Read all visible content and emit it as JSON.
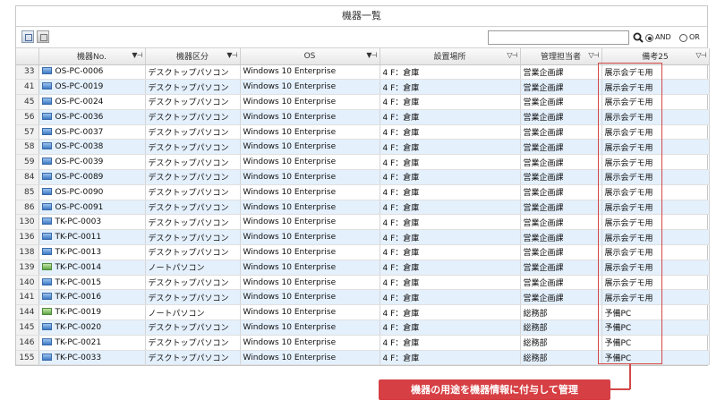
{
  "window": {
    "title": "機器一覧"
  },
  "toolbar": {
    "search": {
      "value": "",
      "placeholder": ""
    },
    "logic": {
      "and_label": "AND",
      "or_label": "OR",
      "selected": "AND"
    }
  },
  "columns": [
    {
      "label": ""
    },
    {
      "label": "機器No."
    },
    {
      "label": "機器区分"
    },
    {
      "label": "OS"
    },
    {
      "label": "設置場所"
    },
    {
      "label": "管理担当者"
    },
    {
      "label": "備考25"
    }
  ],
  "rows": [
    {
      "num": "33",
      "icon": "desktop-icon",
      "id": "OS-PC-0006",
      "category": "デスクトップパソコン",
      "os": "Windows 10 Enterprise",
      "location": "4 F：倉庫",
      "manager": "営業企画課",
      "note": "展示会デモ用"
    },
    {
      "num": "41",
      "icon": "desktop-icon",
      "id": "OS-PC-0019",
      "category": "デスクトップパソコン",
      "os": "Windows 10 Enterprise",
      "location": "4 F：倉庫",
      "manager": "営業企画課",
      "note": "展示会デモ用"
    },
    {
      "num": "45",
      "icon": "desktop-icon",
      "id": "OS-PC-0024",
      "category": "デスクトップパソコン",
      "os": "Windows 10 Enterprise",
      "location": "4 F：倉庫",
      "manager": "営業企画課",
      "note": "展示会デモ用"
    },
    {
      "num": "56",
      "icon": "desktop-icon",
      "id": "OS-PC-0036",
      "category": "デスクトップパソコン",
      "os": "Windows 10 Enterprise",
      "location": "4 F：倉庫",
      "manager": "営業企画課",
      "note": "展示会デモ用"
    },
    {
      "num": "57",
      "icon": "desktop-icon",
      "id": "OS-PC-0037",
      "category": "デスクトップパソコン",
      "os": "Windows 10 Enterprise",
      "location": "4 F：倉庫",
      "manager": "営業企画課",
      "note": "展示会デモ用"
    },
    {
      "num": "58",
      "icon": "desktop-icon",
      "id": "OS-PC-0038",
      "category": "デスクトップパソコン",
      "os": "Windows 10 Enterprise",
      "location": "4 F：倉庫",
      "manager": "営業企画課",
      "note": "展示会デモ用"
    },
    {
      "num": "59",
      "icon": "desktop-icon",
      "id": "OS-PC-0039",
      "category": "デスクトップパソコン",
      "os": "Windows 10 Enterprise",
      "location": "4 F：倉庫",
      "manager": "営業企画課",
      "note": "展示会デモ用"
    },
    {
      "num": "84",
      "icon": "desktop-icon",
      "id": "OS-PC-0089",
      "category": "デスクトップパソコン",
      "os": "Windows 10 Enterprise",
      "location": "4 F：倉庫",
      "manager": "営業企画課",
      "note": "展示会デモ用"
    },
    {
      "num": "85",
      "icon": "desktop-icon",
      "id": "OS-PC-0090",
      "category": "デスクトップパソコン",
      "os": "Windows 10 Enterprise",
      "location": "4 F：倉庫",
      "manager": "営業企画課",
      "note": "展示会デモ用"
    },
    {
      "num": "86",
      "icon": "desktop-icon",
      "id": "OS-PC-0091",
      "category": "デスクトップパソコン",
      "os": "Windows 10 Enterprise",
      "location": "4 F：倉庫",
      "manager": "営業企画課",
      "note": "展示会デモ用"
    },
    {
      "num": "130",
      "icon": "desktop-icon",
      "id": "TK-PC-0003",
      "category": "デスクトップパソコン",
      "os": "Windows 10 Enterprise",
      "location": "4 F：倉庫",
      "manager": "営業企画課",
      "note": "展示会デモ用"
    },
    {
      "num": "136",
      "icon": "desktop-icon",
      "id": "TK-PC-0011",
      "category": "デスクトップパソコン",
      "os": "Windows 10 Enterprise",
      "location": "4 F：倉庫",
      "manager": "営業企画課",
      "note": "展示会デモ用"
    },
    {
      "num": "138",
      "icon": "desktop-icon",
      "id": "TK-PC-0013",
      "category": "デスクトップパソコン",
      "os": "Windows 10 Enterprise",
      "location": "4 F：倉庫",
      "manager": "営業企画課",
      "note": "展示会デモ用"
    },
    {
      "num": "139",
      "icon": "laptop-icon",
      "id": "TK-PC-0014",
      "category": "ノートパソコン",
      "os": "Windows 10 Enterprise",
      "location": "4 F：倉庫",
      "manager": "営業企画課",
      "note": "展示会デモ用"
    },
    {
      "num": "140",
      "icon": "desktop-icon",
      "id": "TK-PC-0015",
      "category": "デスクトップパソコン",
      "os": "Windows 10 Enterprise",
      "location": "4 F：倉庫",
      "manager": "営業企画課",
      "note": "展示会デモ用"
    },
    {
      "num": "141",
      "icon": "desktop-icon",
      "id": "TK-PC-0016",
      "category": "デスクトップパソコン",
      "os": "Windows 10 Enterprise",
      "location": "4 F：倉庫",
      "manager": "営業企画課",
      "note": "展示会デモ用"
    },
    {
      "num": "144",
      "icon": "laptop-icon",
      "id": "TK-PC-0019",
      "category": "ノートパソコン",
      "os": "Windows 10 Enterprise",
      "location": "4 F：倉庫",
      "manager": "総務部",
      "note": "予備PC"
    },
    {
      "num": "145",
      "icon": "desktop-icon",
      "id": "TK-PC-0020",
      "category": "デスクトップパソコン",
      "os": "Windows 10 Enterprise",
      "location": "4 F：倉庫",
      "manager": "総務部",
      "note": "予備PC"
    },
    {
      "num": "146",
      "icon": "desktop-icon",
      "id": "TK-PC-0021",
      "category": "デスクトップパソコン",
      "os": "Windows 10 Enterprise",
      "location": "4 F：倉庫",
      "manager": "総務部",
      "note": "予備PC"
    },
    {
      "num": "155",
      "icon": "desktop-icon",
      "id": "TK-PC-0033",
      "category": "デスクトップパソコン",
      "os": "Windows 10 Enterprise",
      "location": "4 F：倉庫",
      "manager": "総務部",
      "note": "予備PC"
    }
  ],
  "callout": {
    "text": "機器の用途を機器情報に付与して管理"
  },
  "colors": {
    "highlight": "#d44848",
    "callout_bg": "#d63f43",
    "row_alt": "#e4f0fc"
  }
}
